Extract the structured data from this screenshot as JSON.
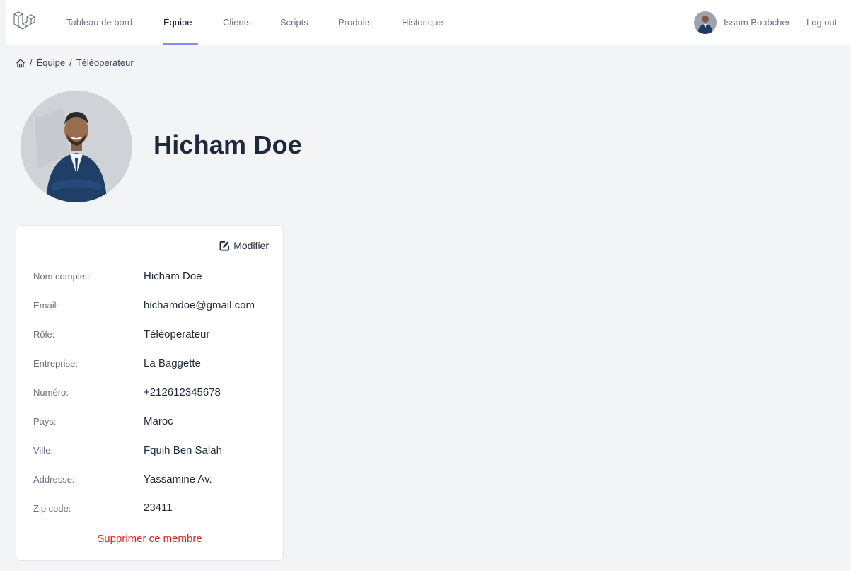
{
  "nav": {
    "items": [
      {
        "label": "Tableau de bord",
        "active": false
      },
      {
        "label": "Équipe",
        "active": true
      },
      {
        "label": "Clients",
        "active": false
      },
      {
        "label": "Scripts",
        "active": false
      },
      {
        "label": "Produits",
        "active": false
      },
      {
        "label": "Historique",
        "active": false
      }
    ],
    "accent_color": "#818cf8"
  },
  "user": {
    "name": "Issam Boubcher",
    "logout_label": "Log out"
  },
  "breadcrumb": {
    "icon": "home-icon",
    "items": [
      "Équipe",
      "Téléoperateur"
    ]
  },
  "profile": {
    "name": "Hicham Doe"
  },
  "card": {
    "edit_label": "Modifier",
    "edit_icon": "edit-icon",
    "fields": [
      {
        "label": "Nom complet:",
        "value": "Hicham Doe"
      },
      {
        "label": "Email:",
        "value": "hichamdoe@gmail.com"
      },
      {
        "label": "Rôle:",
        "value": "Téléoperateur"
      },
      {
        "label": "Entreprise:",
        "value": "La Baggette"
      },
      {
        "label": "Numéro:",
        "value": "+212612345678"
      },
      {
        "label": "Pays:",
        "value": "Maroc"
      },
      {
        "label": "Ville:",
        "value": "Fquih Ben Salah"
      },
      {
        "label": "Addresse:",
        "value": "Yassamine Av."
      },
      {
        "label": "Zip code:",
        "value": "23411"
      }
    ],
    "delete_label": "Supprimer ce membre",
    "delete_color": "#dc2626"
  }
}
